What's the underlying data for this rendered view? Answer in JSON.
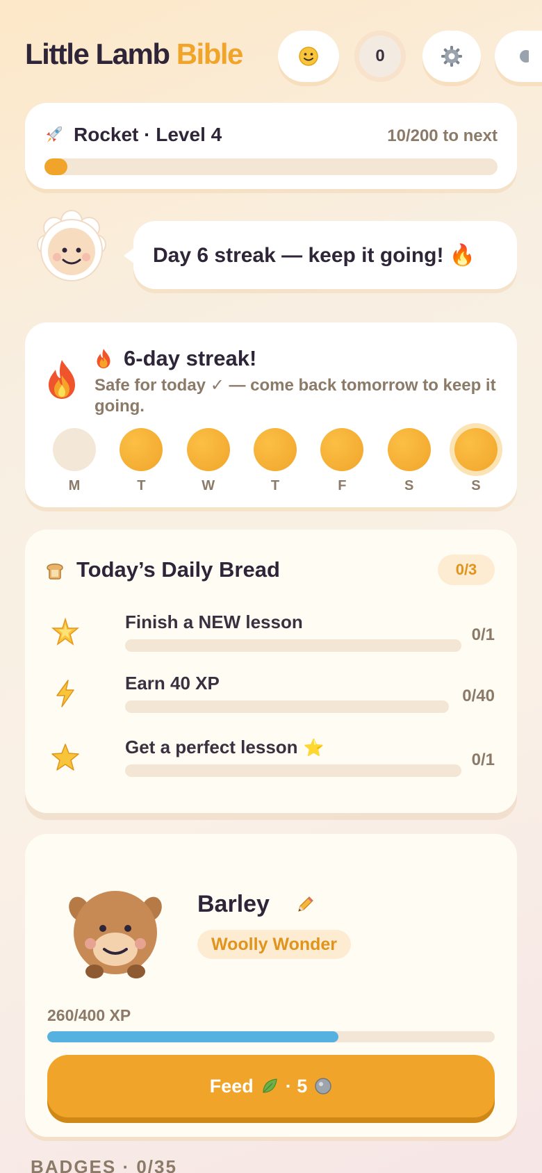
{
  "header": {
    "brand_primary": "Little Lamb",
    "brand_accent": "Bible",
    "mood_icon": "smiley-icon",
    "coin_count": "0",
    "settings_icon": "gear-icon"
  },
  "level": {
    "icon": "rocket-icon",
    "title": "Rocket · Level 4",
    "next": "10/200 to next",
    "progress": 0.05
  },
  "mascot": {
    "message": "Day 6 streak — keep it going! 🔥"
  },
  "streak": {
    "title": "6-day streak!",
    "subtitle": "Safe for today ✓ — come back tomorrow to keep it going.",
    "days": [
      {
        "label": "M",
        "done": false
      },
      {
        "label": "T",
        "done": true
      },
      {
        "label": "W",
        "done": true
      },
      {
        "label": "T",
        "done": true
      },
      {
        "label": "F",
        "done": true
      },
      {
        "label": "S",
        "done": true
      },
      {
        "label": "S",
        "done": true,
        "today": true
      }
    ]
  },
  "daily_bread": {
    "title": "Today’s Daily Bread",
    "count": "0/3",
    "tasks": [
      {
        "label": "Finish a NEW lesson",
        "count": "0/1",
        "icon": "sparkle-star-icon",
        "progress": 0
      },
      {
        "label": "Earn 40 XP",
        "count": "0/40",
        "icon": "lightning-icon",
        "progress": 0
      },
      {
        "label": "Get a perfect lesson",
        "count": "0/1",
        "icon": "star-icon",
        "progress": 0,
        "suffix": "⭐"
      }
    ]
  },
  "pet": {
    "name": "Barley",
    "tag": "Woolly Wonder",
    "xp": "260/400 XP",
    "xp_progress": 0.65,
    "feed_label": "Feed",
    "feed_cost": "· 5"
  },
  "badges": {
    "heading": "BADGES · 0/35"
  },
  "colors": {
    "accent": "#f0a52a",
    "text": "#2e2638",
    "muted": "#8c7a68",
    "xp_bar": "#55b2e0"
  }
}
